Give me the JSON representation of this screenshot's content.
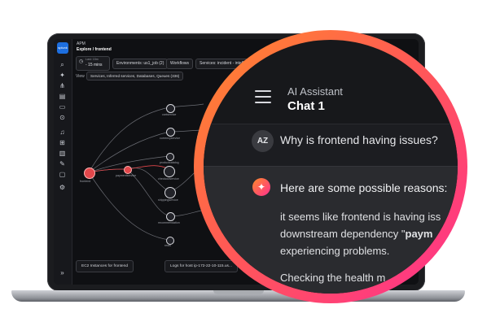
{
  "app": {
    "logo_text": "splunk",
    "breadcrumb_parent": "APM",
    "breadcrumb_current": "Explore / frontend",
    "time_label": "Last: 15m",
    "time_value": "- 15 mins",
    "filters": [
      "Environments: us1_job (2)",
      "Workflows",
      "Services: incident - intell (1)"
    ],
    "view_label": "View",
    "view_value": "Services, Inferred services, Databases, Queues (336)",
    "nodes": [
      {
        "label": "frontend",
        "state": "error"
      },
      {
        "label": "cartservice",
        "state": "ok"
      },
      {
        "label": "currencyservice",
        "state": "ok"
      },
      {
        "label": "productcatalog",
        "state": "ok"
      },
      {
        "label": "paymentservice",
        "state": "error"
      },
      {
        "label": "checkoutservice",
        "state": "ok"
      },
      {
        "label": "shippingservice",
        "state": "ok"
      },
      {
        "label": "recommendation",
        "state": "ok"
      },
      {
        "label": "redis",
        "state": "ok"
      },
      {
        "label": "emailservice",
        "state": "ok"
      }
    ],
    "footer_left": "EC2 Instances for frontend",
    "footer_right": "Logs for host ip-172-22-10-115.us..."
  },
  "assistant": {
    "subtitle": "AI Assistant",
    "title": "Chat 1",
    "user_initials": "AZ",
    "question": "Why is frontend having issues?",
    "answer_intro": "Here are some possible reasons:",
    "answer_line1": "it seems like frontend is having iss",
    "answer_line2_prefix": "downstream dependency \"",
    "answer_line2_bold": "paym",
    "answer_line3": "experiencing problems.",
    "answer_next": "Checking the health m"
  },
  "colors": {
    "ring_start": "#ff8a2a",
    "ring_end": "#ff2f8f",
    "error_node": "#e2474b",
    "accent": "#1d6fe0"
  }
}
